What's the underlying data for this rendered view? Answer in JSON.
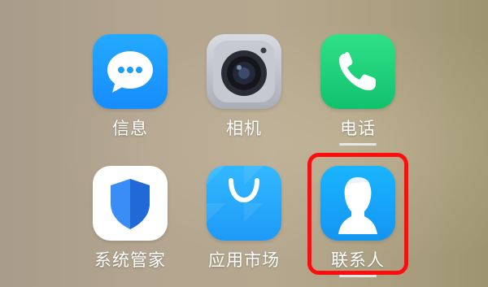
{
  "home_screen": {
    "apps": [
      {
        "label": "信息",
        "icon": "message-bubble-icon",
        "color": "#168dfc",
        "has_underline": false
      },
      {
        "label": "相机",
        "icon": "camera-lens-icon",
        "color": "#a9adb7",
        "has_underline": false
      },
      {
        "label": "电话",
        "icon": "phone-handset-icon",
        "color": "#11c26c",
        "has_underline": true
      },
      {
        "label": "系统管家",
        "icon": "shield-icon",
        "color": "#2f7cf0",
        "has_underline": false
      },
      {
        "label": "应用市场",
        "icon": "shopping-bag-icon",
        "color": "#1d9af6",
        "has_underline": false
      },
      {
        "label": "联系人",
        "icon": "person-silhouette-icon",
        "color": "#1495f2",
        "has_underline": true
      }
    ],
    "highlight": {
      "target": "联系人",
      "color": "#ff0d0d"
    }
  }
}
